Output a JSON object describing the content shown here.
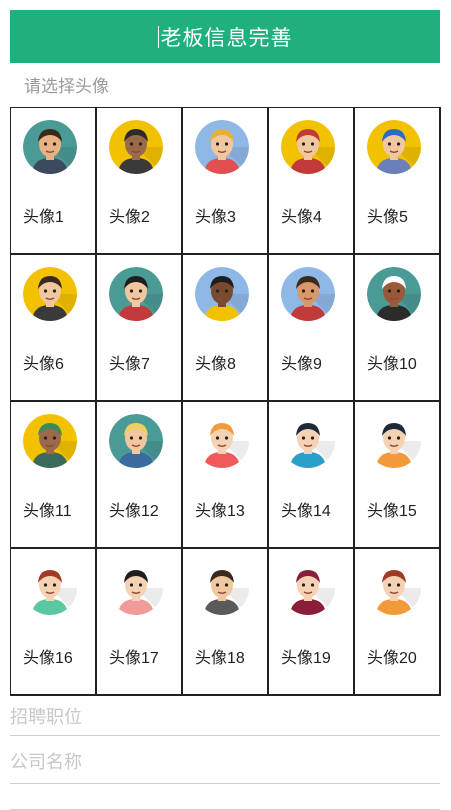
{
  "header": {
    "title": "老板信息完善"
  },
  "avatar_section": {
    "label": "请选择头像"
  },
  "avatars": [
    {
      "label": "头像1",
      "bg": "#4a9a96",
      "skin": "#e8b184",
      "hair": "#3a2a1e",
      "shirt": "#3b4a5e"
    },
    {
      "label": "头像2",
      "bg": "#f2c200",
      "skin": "#9a6a4a",
      "hair": "#2b2b2b",
      "shirt": "#3a3a3a"
    },
    {
      "label": "头像3",
      "bg": "#8fb8e6",
      "skin": "#f1c7a0",
      "hair": "#e2b23a",
      "shirt": "#e05050"
    },
    {
      "label": "头像4",
      "bg": "#f2c200",
      "skin": "#f1c7a0",
      "hair": "#c23a3a",
      "shirt": "#c23a3a"
    },
    {
      "label": "头像5",
      "bg": "#f2c200",
      "skin": "#f1c7a0",
      "hair": "#2b6ac6",
      "shirt": "#6b7fb8"
    },
    {
      "label": "头像6",
      "bg": "#f2c200",
      "skin": "#f1c7a0",
      "hair": "#3a2a1e",
      "shirt": "#3a3a3a"
    },
    {
      "label": "头像7",
      "bg": "#4a9a96",
      "skin": "#f1c7a0",
      "hair": "#1e1e1e",
      "shirt": "#c23a3a"
    },
    {
      "label": "头像8",
      "bg": "#8fb8e6",
      "skin": "#7a4a2e",
      "hair": "#1e1e1e",
      "shirt": "#f2c200"
    },
    {
      "label": "头像9",
      "bg": "#8fb8e6",
      "skin": "#d9976a",
      "hair": "#3a2a1e",
      "shirt": "#c23a3a"
    },
    {
      "label": "头像10",
      "bg": "#4a9a96",
      "skin": "#9a5a3a",
      "hair": "#ffffff",
      "shirt": "#2b2b2b"
    },
    {
      "label": "头像11",
      "bg": "#f2c200",
      "skin": "#9a6a4a",
      "hair": "#3a8a5a",
      "shirt": "#3a6a5a"
    },
    {
      "label": "头像12",
      "bg": "#4a9a96",
      "skin": "#f1c7a0",
      "hair": "#f2d060",
      "shirt": "#3a6aa0"
    },
    {
      "label": "头像13",
      "bg": "#ffffff",
      "skin": "#f6d2b4",
      "hair": "#f29a3a",
      "shirt": "#f05a5a"
    },
    {
      "label": "头像14",
      "bg": "#ffffff",
      "skin": "#f6d2b4",
      "hair": "#1e2a3a",
      "shirt": "#2aa0c8"
    },
    {
      "label": "头像15",
      "bg": "#ffffff",
      "skin": "#f6d2b4",
      "hair": "#1e2a3a",
      "shirt": "#f29a3a"
    },
    {
      "label": "头像16",
      "bg": "#ffffff",
      "skin": "#f6d2b4",
      "hair": "#a23a2a",
      "shirt": "#5ac8a0"
    },
    {
      "label": "头像17",
      "bg": "#ffffff",
      "skin": "#f6d2b4",
      "hair": "#1e1e1e",
      "shirt": "#f29a9a"
    },
    {
      "label": "头像18",
      "bg": "#ffffff",
      "skin": "#f1c7a0",
      "hair": "#3a2a1e",
      "shirt": "#5a5a5a"
    },
    {
      "label": "头像19",
      "bg": "#ffffff",
      "skin": "#f6d2b4",
      "hair": "#8a1e3a",
      "shirt": "#8a1e3a"
    },
    {
      "label": "头像20",
      "bg": "#ffffff",
      "skin": "#f6d2b4",
      "hair": "#a23a2a",
      "shirt": "#f29a3a"
    }
  ],
  "fields": {
    "position_placeholder": "招聘职位",
    "company_placeholder": "公司名称",
    "salary_placeholder": ""
  },
  "colors": {
    "header_bg": "#1fb07e",
    "border": "#222222",
    "placeholder": "#c8c8c8"
  }
}
